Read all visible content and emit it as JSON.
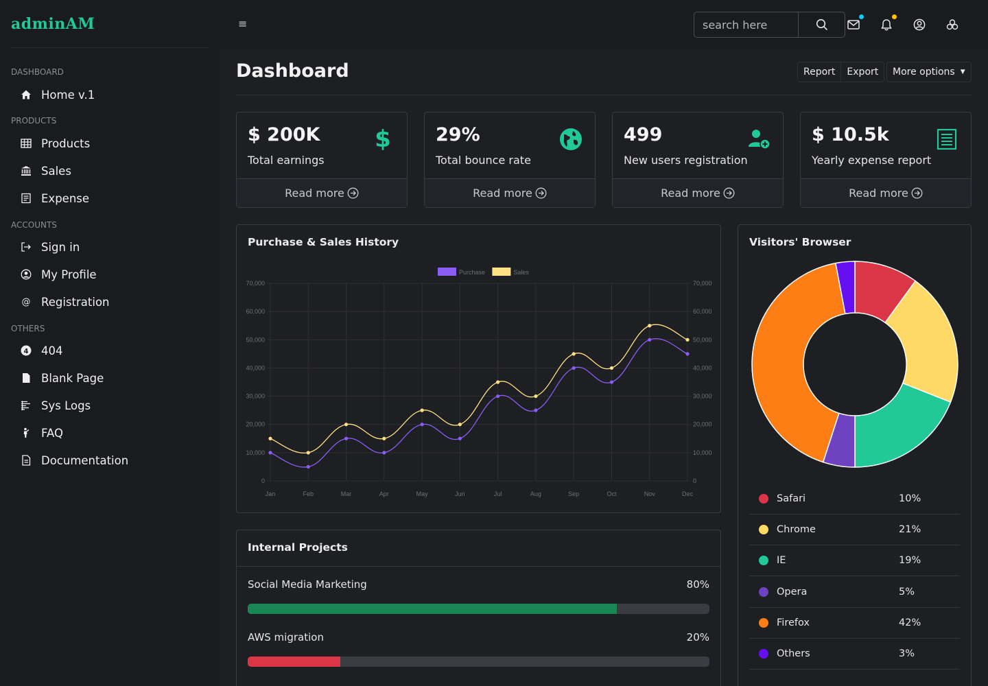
{
  "brand": "adminAM",
  "sidebar": {
    "sections": [
      {
        "title": "DASHBOARD",
        "items": [
          {
            "label": "Home v.1",
            "icon": "home-icon"
          }
        ]
      },
      {
        "title": "PRODUCTS",
        "items": [
          {
            "label": "Products",
            "icon": "table-icon"
          },
          {
            "label": "Sales",
            "icon": "bank-icon"
          },
          {
            "label": "Expense",
            "icon": "receipt-icon"
          }
        ]
      },
      {
        "title": "ACCOUNTS",
        "items": [
          {
            "label": "Sign in",
            "icon": "sign-in-icon"
          },
          {
            "label": "My Profile",
            "icon": "user-circle-icon"
          },
          {
            "label": "Registration",
            "icon": "at-icon"
          }
        ]
      },
      {
        "title": "OTHERS",
        "items": [
          {
            "label": "404",
            "icon": "number-4-icon"
          },
          {
            "label": "Blank Page",
            "icon": "file-icon"
          },
          {
            "label": "Sys Logs",
            "icon": "logs-icon"
          },
          {
            "label": "FAQ",
            "icon": "person-icon"
          },
          {
            "label": "Documentation",
            "icon": "document-icon"
          }
        ]
      }
    ]
  },
  "topbar": {
    "search_placeholder": "search here",
    "icons": [
      "envelope-icon",
      "bell-icon",
      "user-icon",
      "apps-icon"
    ],
    "badge_colors": {
      "mail": "#0dcaf0",
      "bell": "#ffc107"
    }
  },
  "page": {
    "title": "Dashboard",
    "buttons": {
      "report": "Report",
      "export": "Export",
      "more": "More options"
    }
  },
  "stats": [
    {
      "value": "$ 200K",
      "label": "Total earnings",
      "icon": "dollar-icon",
      "link": "Read more"
    },
    {
      "value": "29%",
      "label": "Total bounce rate",
      "icon": "globe-icon",
      "link": "Read more"
    },
    {
      "value": "499",
      "label": "New users registration",
      "icon": "user-plus-icon",
      "link": "Read more"
    },
    {
      "value": "$ 10.5k",
      "label": "Yearly expense report",
      "icon": "receipt-icon",
      "link": "Read more"
    }
  ],
  "colors": {
    "accent": "#20c997",
    "purchase": "#8b5cf6",
    "sales": "#ffe083"
  },
  "chart_panel": {
    "title": "Purchase & Sales History"
  },
  "chart_data": {
    "type": "line",
    "categories": [
      "Jan",
      "Feb",
      "Mar",
      "Apr",
      "May",
      "Jun",
      "Jul",
      "Aug",
      "Sep",
      "Oct",
      "Nov",
      "Dec"
    ],
    "series": [
      {
        "name": "Purchase",
        "color": "#8b5cf6",
        "values": [
          10000,
          5000,
          15000,
          10000,
          20000,
          15000,
          30000,
          25000,
          40000,
          35000,
          50000,
          45000
        ]
      },
      {
        "name": "Sales",
        "color": "#ffe083",
        "values": [
          15000,
          10000,
          20000,
          15000,
          25000,
          20000,
          35000,
          30000,
          45000,
          40000,
          55000,
          50000
        ]
      }
    ],
    "yticks": [
      "0",
      "10,000",
      "20,000",
      "30,000",
      "40,000",
      "50,000",
      "60,000",
      "70,000"
    ],
    "ylim": [
      0,
      70000
    ],
    "legend": "top-center",
    "grid": true
  },
  "browser_panel": {
    "title": "Visitors' Browser",
    "items": [
      {
        "name": "Safari",
        "pct": "10%",
        "value": 10,
        "color": "#dc3545"
      },
      {
        "name": "Chrome",
        "pct": "21%",
        "value": 21,
        "color": "#ffd966"
      },
      {
        "name": "IE",
        "pct": "19%",
        "value": 19,
        "color": "#20c997"
      },
      {
        "name": "Opera",
        "pct": "5%",
        "value": 5,
        "color": "#6f42c1"
      },
      {
        "name": "Firefox",
        "pct": "42%",
        "value": 42,
        "color": "#fd7e14"
      },
      {
        "name": "Others",
        "pct": "3%",
        "value": 3,
        "color": "#6610f2"
      }
    ]
  },
  "projects_panel": {
    "title": "Internal Projects",
    "items": [
      {
        "name": "Social Media Marketing",
        "pct": "80%",
        "value": 80,
        "color": "#198754"
      },
      {
        "name": "AWS migration",
        "pct": "20%",
        "value": 20,
        "color": "#dc3545"
      }
    ]
  }
}
